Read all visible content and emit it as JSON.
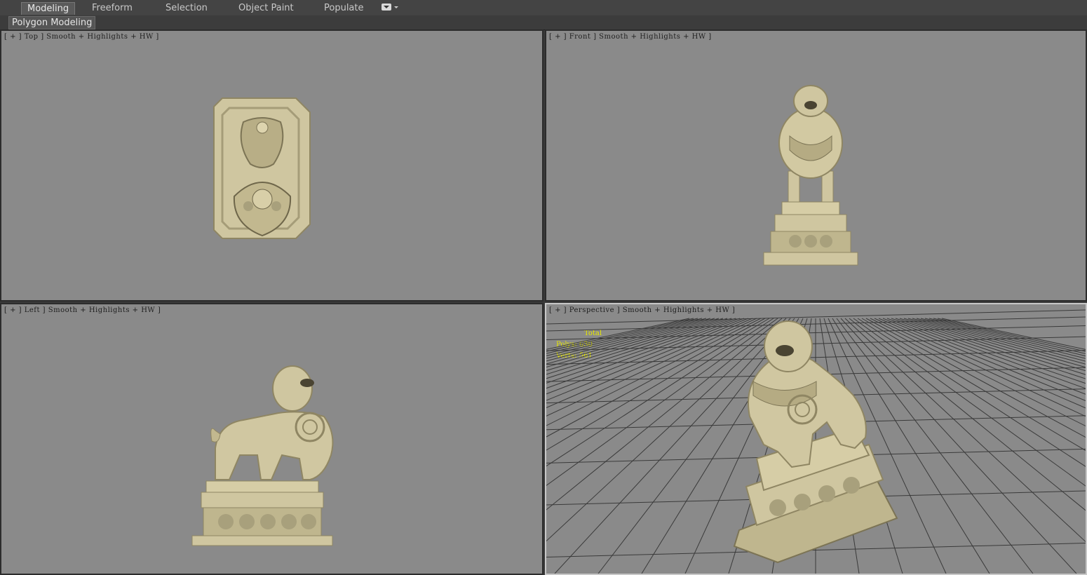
{
  "ribbon": {
    "tabs": [
      {
        "label": "Modeling",
        "active": true
      },
      {
        "label": "Freeform"
      },
      {
        "label": "Selection"
      },
      {
        "label": "Object Paint"
      },
      {
        "label": "Populate"
      }
    ],
    "extra_icon": "dropdown-toggle-icon"
  },
  "subribbon": {
    "label": "Polygon Modeling"
  },
  "viewports": {
    "top": {
      "label": "[ + ] Top ] Smooth + Highlights + HW ]"
    },
    "front": {
      "label": "[ + ] Front ] Smooth + Highlights + HW ]"
    },
    "left": {
      "label": "[ + ] Left ] Smooth + Highlights + HW ]"
    },
    "perspective": {
      "label": "[ + ] Perspective ] Smooth + Highlights + HW ]",
      "stats": {
        "header": "Total",
        "polys": "Polys: 630",
        "verts": "Verts: 561"
      }
    }
  },
  "colors": {
    "viewport_bg": "#8a8a8a",
    "stone": "#cfc6a0",
    "stone_dark": "#8f8663",
    "stats_text": "#e6e600"
  }
}
